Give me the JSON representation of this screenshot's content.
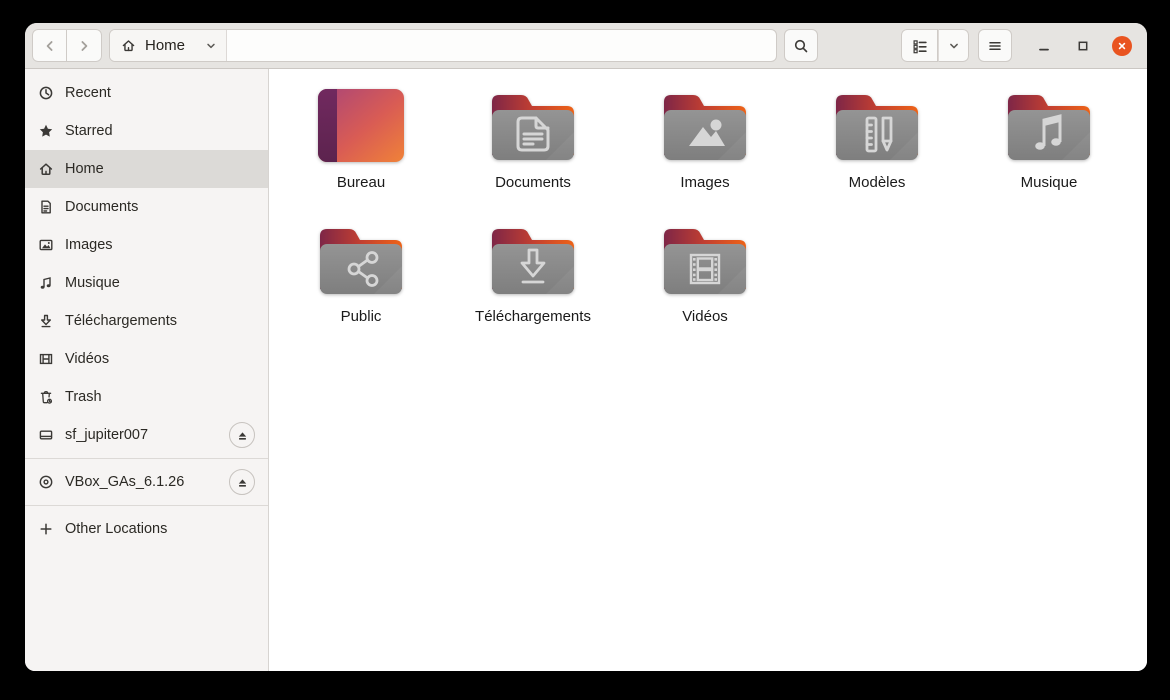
{
  "titlebar": {
    "location_label": "Home"
  },
  "sidebar": {
    "items": [
      {
        "label": "Recent",
        "icon": "clock"
      },
      {
        "label": "Starred",
        "icon": "star"
      },
      {
        "label": "Home",
        "icon": "home",
        "selected": true
      },
      {
        "label": "Documents",
        "icon": "document"
      },
      {
        "label": "Images",
        "icon": "image"
      },
      {
        "label": "Musique",
        "icon": "music-note"
      },
      {
        "label": "Téléchargements",
        "icon": "download-arrow"
      },
      {
        "label": "Vidéos",
        "icon": "film"
      },
      {
        "label": "Trash",
        "icon": "trash-can"
      },
      {
        "label": "sf_jupiter007",
        "icon": "hard-disk",
        "eject": true
      },
      {
        "label": "VBox_GAs_6.1.26",
        "icon": "optical-disc",
        "eject": true
      },
      {
        "label": "Other Locations",
        "icon": "plus"
      }
    ]
  },
  "content": {
    "folders": [
      {
        "name": "Bureau",
        "icon": "desktop-gradient"
      },
      {
        "name": "Documents",
        "icon": "document-glyph"
      },
      {
        "name": "Images",
        "icon": "photo-glyph"
      },
      {
        "name": "Modèles",
        "icon": "ruler-pencil-glyph"
      },
      {
        "name": "Musique",
        "icon": "music-glyph"
      },
      {
        "name": "Public",
        "icon": "share-glyph"
      },
      {
        "name": "Téléchargements",
        "icon": "download-glyph"
      },
      {
        "name": "Vidéos",
        "icon": "film-glyph"
      }
    ]
  },
  "colors": {
    "close_button": "#e95420",
    "headerbar_bg": "#e6e4e1",
    "sidebar_bg": "#f6f4f3",
    "sidebar_selected": "#dcdad7",
    "folder_front": "#8d8d8d",
    "folder_tab_gradient": [
      "#7e2647",
      "#c23f31",
      "#ee6317"
    ],
    "desktop_gradient": [
      "#aa4578",
      "#f08238"
    ]
  }
}
